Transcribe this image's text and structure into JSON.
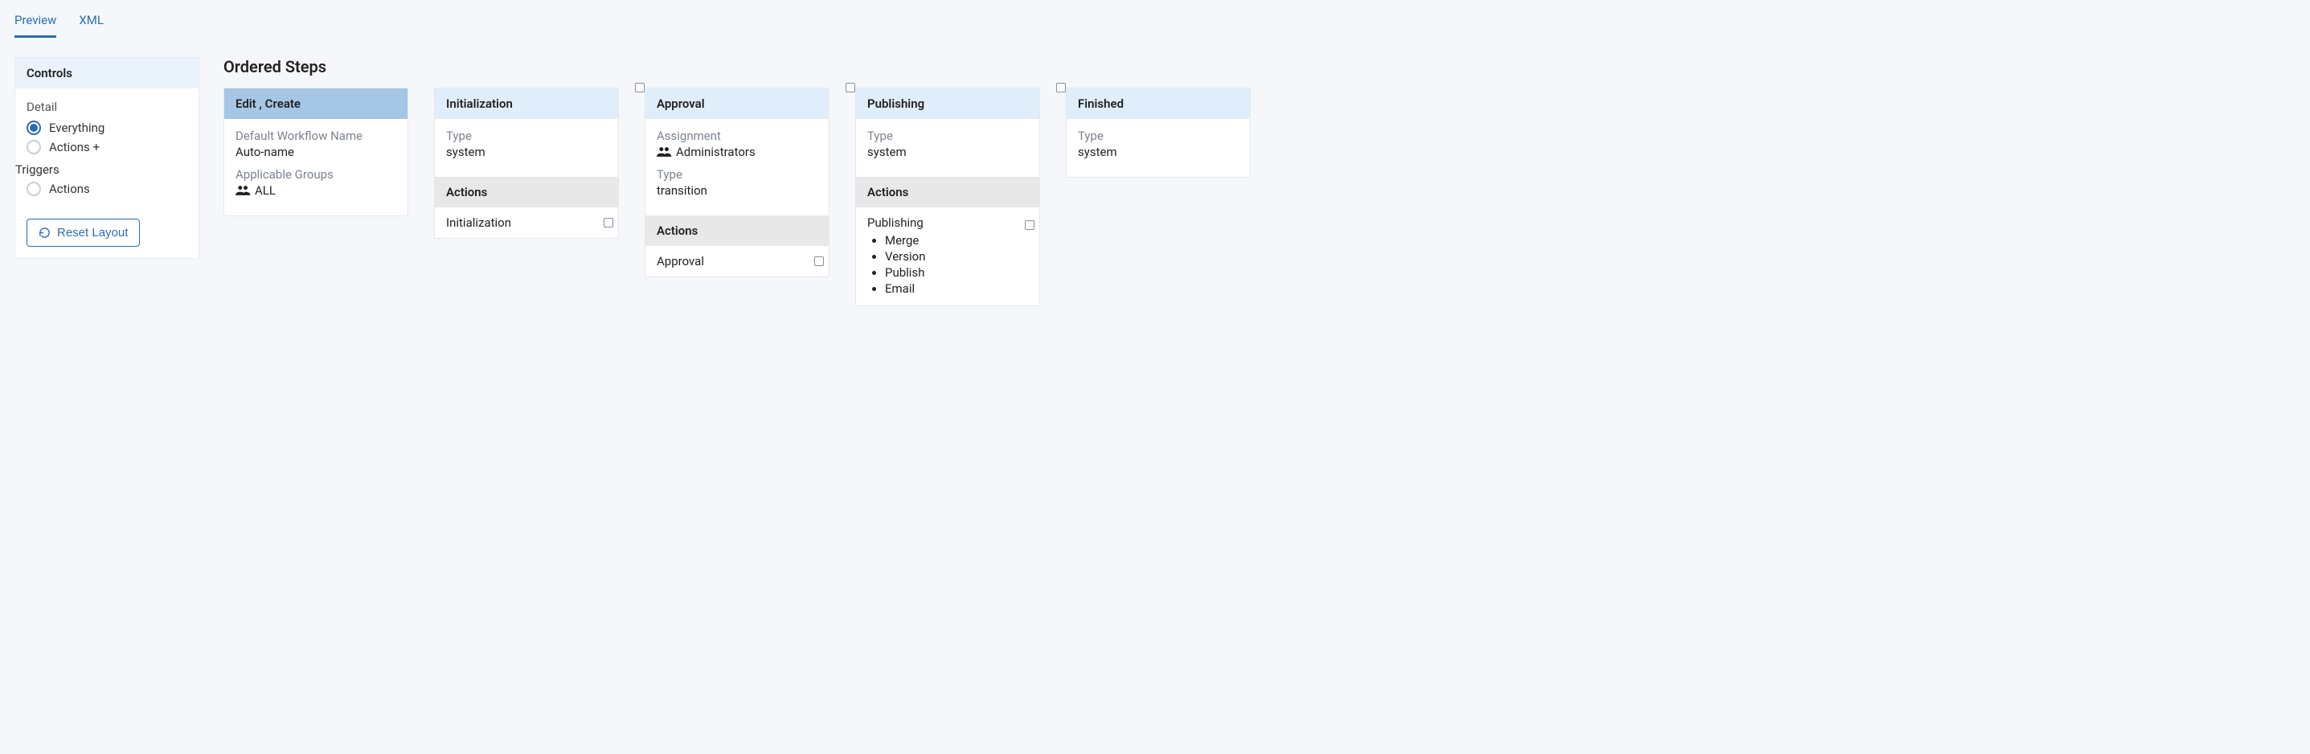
{
  "tabs": {
    "preview": "Preview",
    "xml": "XML"
  },
  "controls": {
    "title": "Controls",
    "detail_label": "Detail",
    "options": {
      "everything": "Everything",
      "actions_triggers_part1": "Actions +",
      "actions_triggers_part2": "Triggers",
      "actions": "Actions"
    },
    "reset_button": "Reset Layout"
  },
  "steps": {
    "title": "Ordered Steps",
    "cards": [
      {
        "title": "Edit , Create",
        "default_wf_label": "Default Workflow Name",
        "default_wf_value": "Auto-name",
        "groups_label": "Applicable Groups",
        "groups_value": "ALL"
      },
      {
        "title": "Initialization",
        "type_label": "Type",
        "type_value": "system",
        "actions_header": "Actions",
        "action_name": "Initialization"
      },
      {
        "title": "Approval",
        "assign_label": "Assignment",
        "assign_value": "Administrators",
        "type_label": "Type",
        "type_value": "transition",
        "actions_header": "Actions",
        "action_name": "Approval"
      },
      {
        "title": "Publishing",
        "type_label": "Type",
        "type_value": "system",
        "actions_header": "Actions",
        "action_name": "Publishing",
        "sub0": "Merge",
        "sub1": "Version",
        "sub2": "Publish",
        "sub3": "Email"
      },
      {
        "title": "Finished",
        "type_label": "Type",
        "type_value": "system"
      }
    ]
  }
}
